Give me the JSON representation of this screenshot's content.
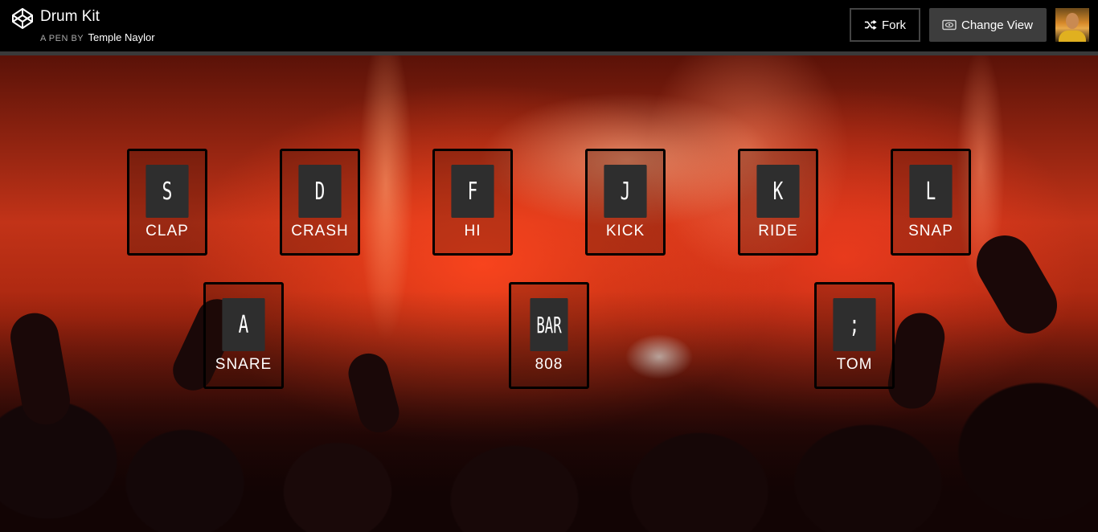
{
  "header": {
    "title": "Drum Kit",
    "byline_prefix": "A PEN BY",
    "author": "Temple Naylor",
    "fork_label": "Fork",
    "change_view_label": "Change View"
  },
  "pads": [
    {
      "key": "S",
      "sound": "CLAP"
    },
    {
      "key": "D",
      "sound": "CRASH"
    },
    {
      "key": "F",
      "sound": "HI"
    },
    {
      "key": "J",
      "sound": "KICK"
    },
    {
      "key": "K",
      "sound": "RIDE"
    },
    {
      "key": "L",
      "sound": "SNAP"
    },
    {
      "key": "A",
      "sound": "SNARE"
    },
    {
      "key": "BAR",
      "sound": "808"
    },
    {
      "key": ";",
      "sound": "TOM"
    }
  ]
}
